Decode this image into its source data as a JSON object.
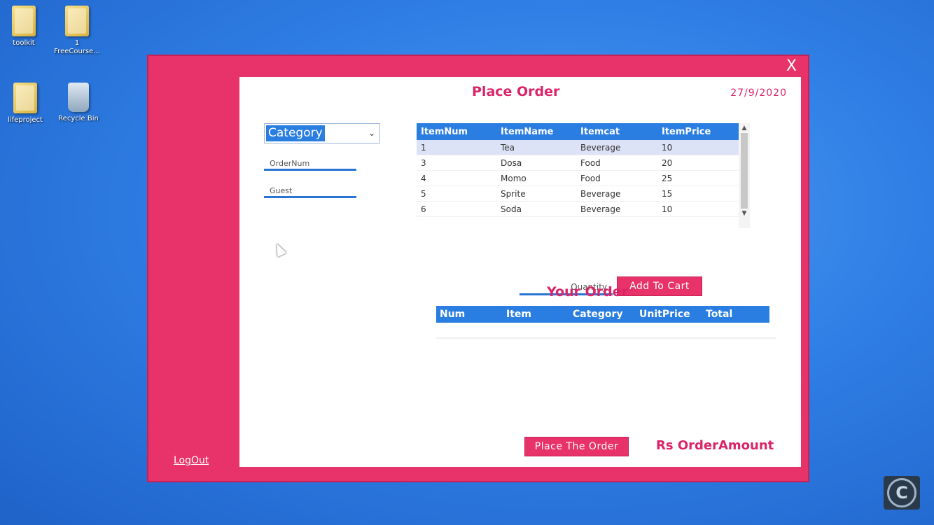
{
  "desktop": {
    "icons": [
      {
        "label": "toolkit",
        "kind": "folder"
      },
      {
        "label": "1\nFreeCourse...",
        "kind": "folder"
      },
      {
        "label": "lifeproject",
        "kind": "folder"
      },
      {
        "label": "Recycle Bin",
        "kind": "recycle-bin"
      }
    ]
  },
  "window": {
    "close_label": "X",
    "logout_label": "LogOut",
    "title": "Place Order",
    "date": "27/9/2020",
    "category_select": {
      "value": "Category"
    },
    "order_num_placeholder": "OrderNum",
    "guest_placeholder": "Guest",
    "items_grid": {
      "headers": [
        "ItemNum",
        "ItemName",
        "Itemcat",
        "ItemPrice"
      ],
      "rows": [
        [
          "1",
          "Tea",
          "Beverage",
          "10"
        ],
        [
          "3",
          "Dosa",
          "Food",
          "20"
        ],
        [
          "4",
          "Momo",
          "Food",
          "25"
        ],
        [
          "5",
          "Sprite",
          "Beverage",
          "15"
        ],
        [
          "6",
          "Soda",
          "Beverage",
          "10"
        ]
      ],
      "selected_row": 0
    },
    "quantity_placeholder": "Quantity",
    "add_to_cart_label": "Add To Cart",
    "your_order_title": "Your Order",
    "order_grid": {
      "headers": [
        "Num",
        "Item",
        "Category",
        "UnitPrice",
        "Total"
      ]
    },
    "place_order_label": "Place The Order",
    "order_amount_label": "Rs OrderAmount"
  },
  "colors": {
    "accent_pink": "#e8326a",
    "header_blue": "#2a7de1"
  }
}
